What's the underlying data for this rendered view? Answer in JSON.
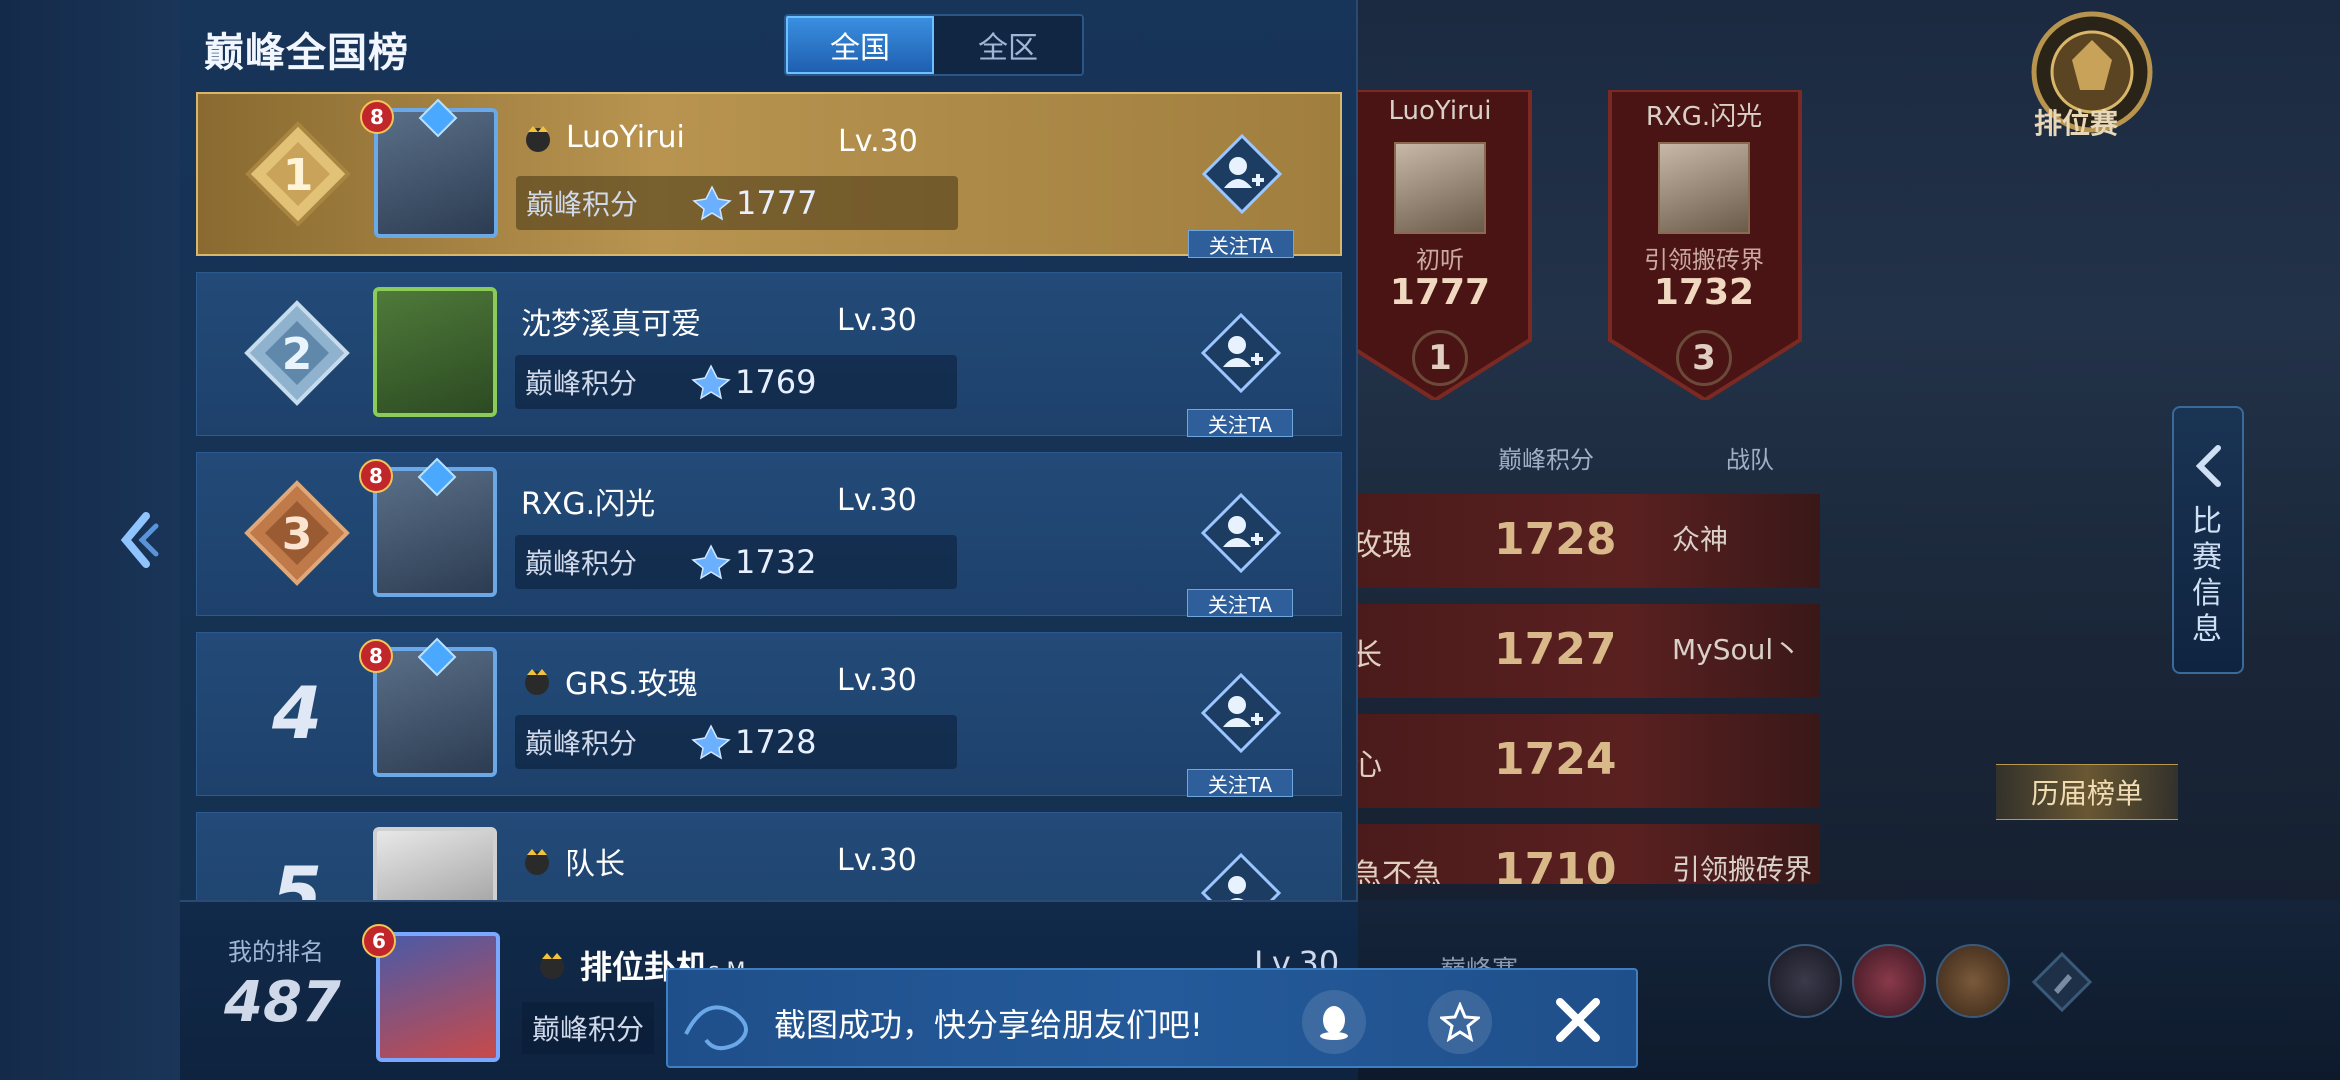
{
  "panel": {
    "title": "巅峰全国榜",
    "tabs": [
      {
        "label": "全国",
        "active": true
      },
      {
        "label": "全区",
        "active": false
      }
    ]
  },
  "score_label": "巅峰积分",
  "follow_label": "关注TA",
  "rows": [
    {
      "rank": "1",
      "name": "LuoYirui",
      "level": "Lv.30",
      "score": "1777",
      "badge": "8",
      "has_crown": true
    },
    {
      "rank": "2",
      "name": "沈梦溪真可爱",
      "level": "Lv.30",
      "score": "1769",
      "badge": "",
      "has_crown": false
    },
    {
      "rank": "3",
      "name": "RXG.闪光",
      "level": "Lv.30",
      "score": "1732",
      "badge": "8",
      "has_crown": false
    },
    {
      "rank": "4",
      "name": "GRS.玫瑰",
      "level": "Lv.30",
      "score": "1728",
      "badge": "8",
      "has_crown": true
    },
    {
      "rank": "5",
      "name": "队长",
      "level": "Lv.30",
      "score": "",
      "badge": "",
      "has_crown": true
    }
  ],
  "my_rank": {
    "label": "我的排名",
    "rank": "487",
    "name": "排位卦机",
    "name_suffix": "s M",
    "level": "Lv.30",
    "badge": "6",
    "score_label": "巅峰积分"
  },
  "podium": [
    {
      "name": "LuoYirui",
      "sub": "初听",
      "score": "1777",
      "rank": "1"
    },
    {
      "name": "RXG.闪光",
      "sub": "引领搬砖界",
      "score": "1732",
      "rank": "3"
    }
  ],
  "table": {
    "headers": {
      "score": "巅峰积分",
      "team": "战队"
    },
    "rows": [
      {
        "left": "玫瑰",
        "score": "1728",
        "team": "众神"
      },
      {
        "left": "长",
        "score": "1727",
        "team": "MySoul丶"
      },
      {
        "left": "心",
        "score": "1724",
        "team": ""
      },
      {
        "left": "急不急",
        "score": "1710",
        "team": "引领搬砖界"
      }
    ]
  },
  "right": {
    "rank_mode_label": "排位赛",
    "side_tab_label": "比赛信息",
    "history_label": "历届榜单",
    "peak_label": "巅峰赛"
  },
  "toast": {
    "text": "截图成功，快分享给朋友们吧!"
  },
  "colors": {
    "accent": "#3a8fe0",
    "gold": "#d9b76a",
    "panel": "#173459"
  }
}
